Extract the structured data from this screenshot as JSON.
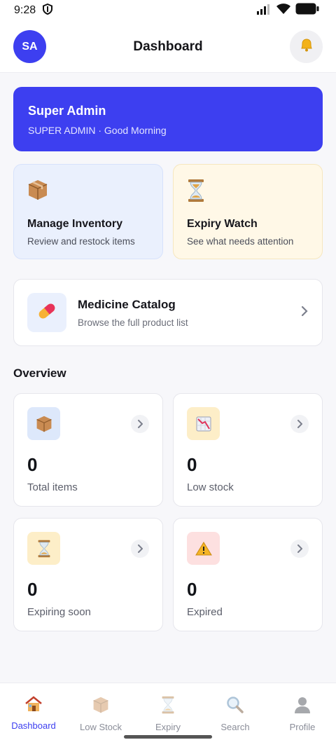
{
  "status_bar": {
    "time": "9:28"
  },
  "header": {
    "avatar_initials": "SA",
    "title": "Dashboard"
  },
  "greeting": {
    "name": "Super Admin",
    "subtitle": "SUPER ADMIN · Good Morning",
    "bg_color": "#3d3ff0"
  },
  "actions": [
    {
      "title": "Manage Inventory",
      "desc": "Review and restock items",
      "icon": "package-icon"
    },
    {
      "title": "Expiry Watch",
      "desc": "See what needs attention",
      "icon": "hourglass-icon"
    }
  ],
  "catalog": {
    "title": "Medicine Catalog",
    "desc": "Browse the full product list",
    "icon": "pill-icon"
  },
  "overview": {
    "title": "Overview",
    "stats": [
      {
        "value": "0",
        "label": "Total items",
        "icon": "package-icon"
      },
      {
        "value": "0",
        "label": "Low stock",
        "icon": "chart-down-icon"
      },
      {
        "value": "0",
        "label": "Expiring soon",
        "icon": "hourglass-icon"
      },
      {
        "value": "0",
        "label": "Expired",
        "icon": "warning-icon"
      }
    ]
  },
  "bottom_nav": [
    {
      "label": "Dashboard",
      "icon": "home-icon",
      "active": true
    },
    {
      "label": "Low Stock",
      "icon": "package-icon",
      "active": false
    },
    {
      "label": "Expiry",
      "icon": "hourglass-icon",
      "active": false
    },
    {
      "label": "Search",
      "icon": "search-icon",
      "active": false
    },
    {
      "label": "Profile",
      "icon": "profile-icon",
      "active": false
    }
  ]
}
